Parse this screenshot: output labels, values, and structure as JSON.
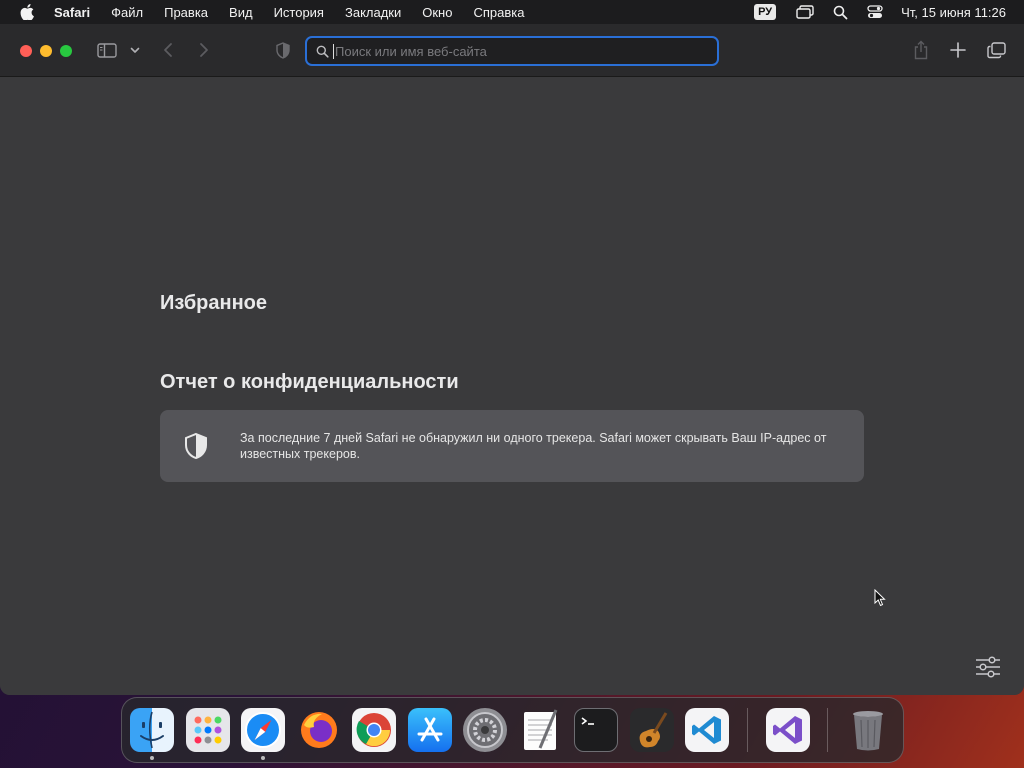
{
  "menubar": {
    "app_name": "Safari",
    "items": [
      "Файл",
      "Правка",
      "Вид",
      "История",
      "Закладки",
      "Окно",
      "Справка"
    ],
    "input_source": "РУ",
    "clock": "Чт, 15 июня  11:26"
  },
  "toolbar": {
    "address_placeholder": "Поиск или имя веб-сайта"
  },
  "start_page": {
    "favorites_heading": "Избранное",
    "privacy_heading": "Отчет о конфиденциальности",
    "privacy_text": "За последние 7 дней Safari не обнаружил ни одного трекера. Safari может скрывать Ваш IP-адрес от известных трекеров."
  },
  "dock": {
    "apps": [
      "finder-icon",
      "launchpad-icon",
      "safari-icon",
      "firefox-icon",
      "chrome-icon",
      "app-store-icon",
      "system-settings-icon",
      "textedit-icon",
      "terminal-icon",
      "garageband-icon",
      "vscode-icon",
      "visual-studio-icon",
      "trash-icon"
    ],
    "running": [
      "finder-icon",
      "safari-icon"
    ]
  },
  "colors": {
    "accent": "#2a6fd6",
    "window_bg": "#3a3a3c",
    "card_bg": "#545458"
  }
}
